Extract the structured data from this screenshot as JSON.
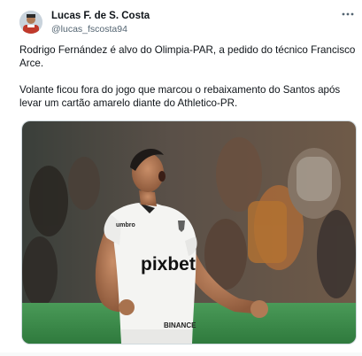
{
  "author": {
    "name": "Lucas F. de S. Costa",
    "handle": "@lucas_fscosta94"
  },
  "menu_icon": "more-horizontal-icon",
  "tweet": {
    "paragraph_1": "Rodrigo Fernández é alvo do Olimpia-PAR, a pedido do técnico Francisco Arce.",
    "paragraph_2": "Volante ficou fora do jogo que marcou o rebaixamento do Santos após levar um cartão amarelo diante do Athletico-PR."
  },
  "photo": {
    "jersey_sponsor": "pixbet",
    "lower_sponsor": "BINANCE",
    "kit_brand": "umbro",
    "colors": {
      "jersey": "#f4f4f2",
      "pitch": "#3c8a4a",
      "crowd_dark": "#2a2622",
      "crowd_warm": "#a86a3a"
    }
  }
}
